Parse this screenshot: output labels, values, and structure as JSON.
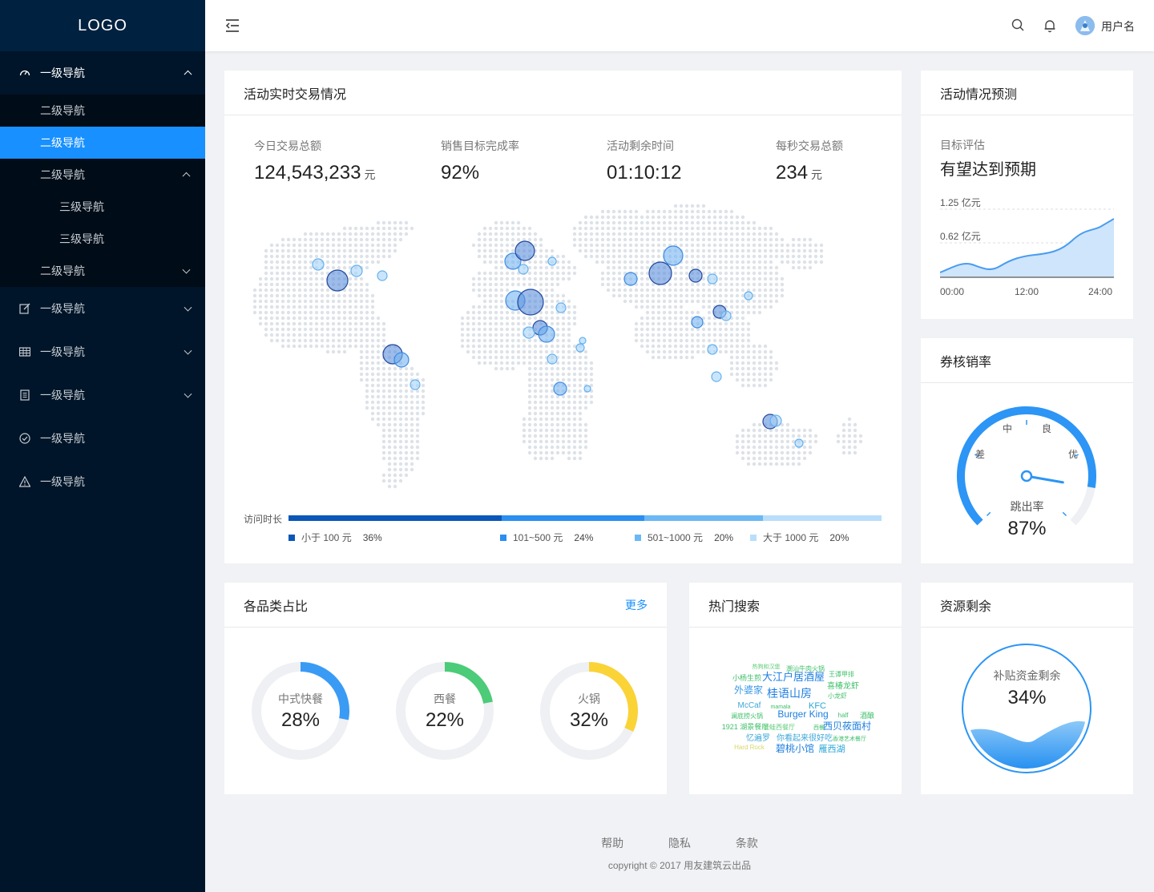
{
  "sidebar": {
    "logo": "LOGO",
    "items": [
      {
        "label": "一级导航",
        "icon": "dashboard-icon"
      },
      {
        "label": "一级导航",
        "icon": "edit-icon"
      },
      {
        "label": "一级导航",
        "icon": "table-icon"
      },
      {
        "label": "一级导航",
        "icon": "profile-icon"
      },
      {
        "label": "一级导航",
        "icon": "check-circle-icon"
      },
      {
        "label": "一级导航",
        "icon": "warning-icon"
      }
    ],
    "sub": {
      "l2_a": "二级导航",
      "l2_active": "二级导航",
      "l2_open": "二级导航",
      "l3_a": "三级导航",
      "l3_b": "三级导航",
      "l2_closed": "二级导航"
    }
  },
  "header": {
    "username": "用户名"
  },
  "realtime": {
    "title": "活动实时交易情况",
    "stats": [
      {
        "label": "今日交易总额",
        "value": "124,543,233",
        "unit": "元"
      },
      {
        "label": "销售目标完成率",
        "value": "92%",
        "unit": ""
      },
      {
        "label": "活动剩余时间",
        "value": "01:10:12",
        "unit": ""
      },
      {
        "label": "每秒交易总额",
        "value": "234",
        "unit": "元"
      }
    ],
    "visit_label": "访问时长",
    "segments": [
      {
        "label": "小于 100 元",
        "pct": "36%",
        "value": 36,
        "color": "#0b57b8"
      },
      {
        "label": "101~500 元",
        "pct": "24%",
        "value": 24,
        "color": "#2a8ff0"
      },
      {
        "label": "501~1000 元",
        "pct": "20%",
        "value": 20,
        "color": "#6bb8f5"
      },
      {
        "label": "大于 1000 元",
        "pct": "20%",
        "value": 20,
        "color": "#b9defa"
      }
    ]
  },
  "forecast": {
    "title": "活动情况预测",
    "eval_label": "目标评估",
    "eval_value": "有望达到预期",
    "y_labels": [
      "1.25 亿元",
      "0.62 亿元"
    ],
    "x_labels": [
      "00:00",
      "12:00",
      "24:00"
    ]
  },
  "gauge": {
    "title": "券核销率",
    "labels": [
      "差",
      "中",
      "良",
      "优"
    ],
    "caption": "跳出率",
    "value_text": "87%",
    "value": 87
  },
  "category": {
    "title": "各品类占比",
    "more": "更多",
    "items": [
      {
        "name": "中式快餐",
        "pct": "28%",
        "value": 28,
        "color": "#3a9bf5"
      },
      {
        "name": "西餐",
        "pct": "22%",
        "value": 22,
        "color": "#4ccb78"
      },
      {
        "name": "火锅",
        "pct": "32%",
        "value": 32,
        "color": "#fad337"
      }
    ]
  },
  "hot": {
    "title": "热门搜索",
    "words": [
      "大江户居酒屋",
      "桂语山房",
      "碧桃小馆",
      "西贝莜面村",
      "外婆家",
      "Burger King",
      "KFC",
      "McCaf",
      "小杨生煎",
      "雁西湖",
      "喜椿龙虾",
      "小龙虾",
      "你看起来很好吃",
      "忆遍罗",
      "1921 湖景餐厅",
      "潮汕牛肉火锅",
      "王谭甲排",
      "热狗和汉堡",
      "Hard Rock",
      "mamala",
      "西餐",
      "half",
      "酒酿",
      "澜底捞火锅",
      "蛙蛙西餐厅",
      "香港艺术餐厅"
    ]
  },
  "resource": {
    "title": "资源剩余",
    "label": "补贴资金剩余",
    "value_text": "34%",
    "value": 34
  },
  "footer": {
    "links": [
      "帮助",
      "隐私",
      "条款"
    ],
    "copyright": "copyright © 2017 用友建筑云出品"
  },
  "colors": {
    "primary": "#1890ff",
    "sidebar": "#001529"
  }
}
